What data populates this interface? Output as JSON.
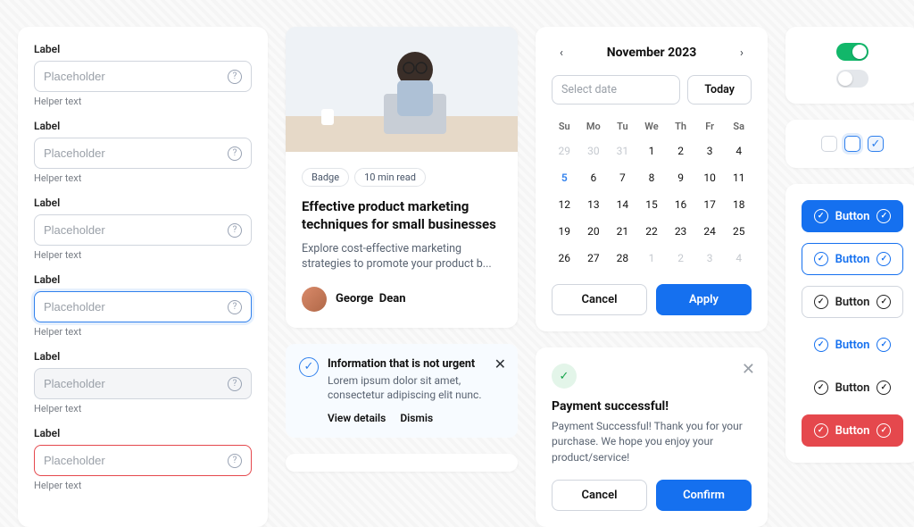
{
  "form": {
    "fields": [
      {
        "label": "Label",
        "placeholder": "Placeholder",
        "helper": "Helper text",
        "state": "default"
      },
      {
        "label": "Label",
        "placeholder": "Placeholder",
        "helper": "Helper text",
        "state": "default"
      },
      {
        "label": "Label",
        "placeholder": "Placeholder",
        "helper": "Helper text",
        "state": "default"
      },
      {
        "label": "Label",
        "placeholder": "Placeholder",
        "helper": "Helper text",
        "state": "focused"
      },
      {
        "label": "Label",
        "placeholder": "Placeholder",
        "helper": "Helper text",
        "state": "disabled"
      },
      {
        "label": "Label",
        "placeholder": "Placeholder",
        "helper": "Helper text",
        "state": "error"
      }
    ]
  },
  "article": {
    "badge": "Badge",
    "read_time": "10 min read",
    "title": "Effective product marketing techniques for small businesses",
    "subtitle": "Explore cost-effective marketing strategies to promote your product b...",
    "author_first": "George",
    "author_last": "Dean"
  },
  "alert": {
    "title": "Information that is not urgent",
    "text": "Lorem ipsum dolor sit amet, consectetur adipiscing elit nunc.",
    "view_details": "View details",
    "dismiss": "Dismis"
  },
  "calendar": {
    "month": "November 2023",
    "select_placeholder": "Select date",
    "today_label": "Today",
    "weekdays": [
      "Su",
      "Mo",
      "Tu",
      "We",
      "Th",
      "Fr",
      "Sa"
    ],
    "days": [
      {
        "n": 29,
        "muted": true
      },
      {
        "n": 30,
        "muted": true
      },
      {
        "n": 31,
        "muted": true
      },
      {
        "n": 1
      },
      {
        "n": 2
      },
      {
        "n": 3
      },
      {
        "n": 4
      },
      {
        "n": 5,
        "selected": true
      },
      {
        "n": 6
      },
      {
        "n": 7
      },
      {
        "n": 8
      },
      {
        "n": 9
      },
      {
        "n": 10
      },
      {
        "n": 11
      },
      {
        "n": 12
      },
      {
        "n": 13
      },
      {
        "n": 14
      },
      {
        "n": 15
      },
      {
        "n": 16
      },
      {
        "n": 17
      },
      {
        "n": 18
      },
      {
        "n": 19
      },
      {
        "n": 20
      },
      {
        "n": 21
      },
      {
        "n": 22
      },
      {
        "n": 23
      },
      {
        "n": 24
      },
      {
        "n": 25
      },
      {
        "n": 26
      },
      {
        "n": 27
      },
      {
        "n": 28
      },
      {
        "n": 1,
        "muted": true
      },
      {
        "n": 2,
        "muted": true
      },
      {
        "n": 3,
        "muted": true
      },
      {
        "n": 4,
        "muted": true
      }
    ],
    "cancel": "Cancel",
    "apply": "Apply"
  },
  "payment": {
    "title": "Payment successful!",
    "text": "Payment Successful! Thank you for your purchase. We hope you enjoy your product/service!",
    "cancel": "Cancel",
    "confirm": "Confirm"
  },
  "buttons": {
    "label": "Button"
  }
}
